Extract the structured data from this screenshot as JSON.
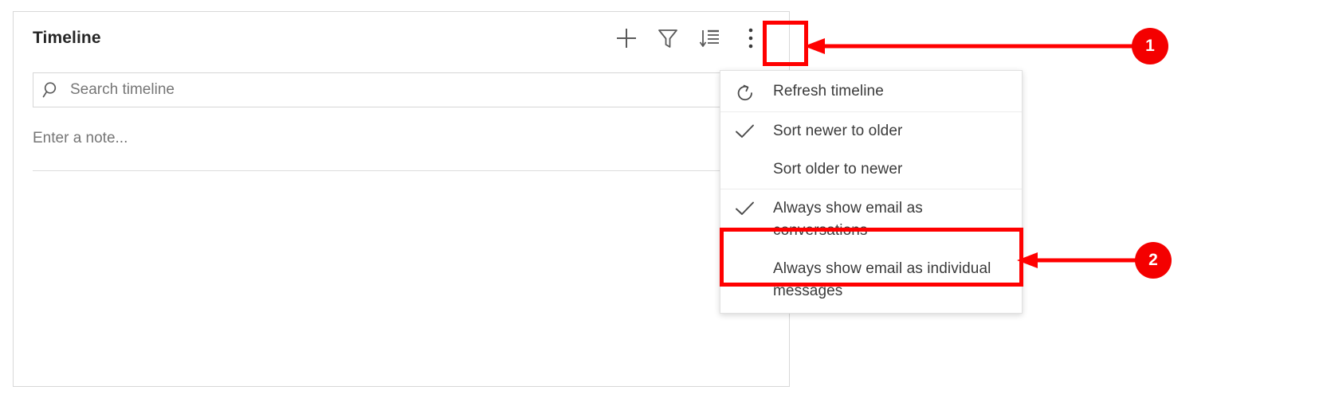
{
  "panel": {
    "title": "Timeline",
    "actions": [
      {
        "name": "add-record-button",
        "icon": "plus-icon",
        "label": "Add"
      },
      {
        "name": "filter-button",
        "icon": "filter-funnel-icon",
        "label": "Filter"
      },
      {
        "name": "sort-button",
        "icon": "sort-descending-icon",
        "label": "Sort"
      },
      {
        "name": "more-commands-button",
        "icon": "more-vertical-dots-icon",
        "label": "More commands"
      }
    ],
    "search": {
      "icon": "search-magnifier-icon",
      "placeholder": "Search timeline",
      "value": ""
    },
    "note": {
      "placeholder": "Enter a note...",
      "value": ""
    }
  },
  "menu": {
    "groups": [
      {
        "items": [
          {
            "label": "Refresh timeline",
            "icon": "refresh-circular-arrow-icon",
            "checked": false
          }
        ]
      },
      {
        "items": [
          {
            "label": "Sort newer to older",
            "icon": "checkmark-icon",
            "checked": true
          },
          {
            "label": "Sort older to newer",
            "icon": "",
            "checked": false
          }
        ]
      },
      {
        "items": [
          {
            "label": "Always show email as conversations",
            "icon": "checkmark-icon",
            "checked": true
          },
          {
            "label": "Always show email as individual messages",
            "icon": "",
            "checked": false
          }
        ]
      }
    ]
  },
  "annotations": {
    "accent_color": "#f40000",
    "callouts": [
      {
        "number": "1",
        "target": "more-commands-button"
      },
      {
        "number": "2",
        "target": "always-show-email-as-conversations-menu-item"
      }
    ]
  }
}
